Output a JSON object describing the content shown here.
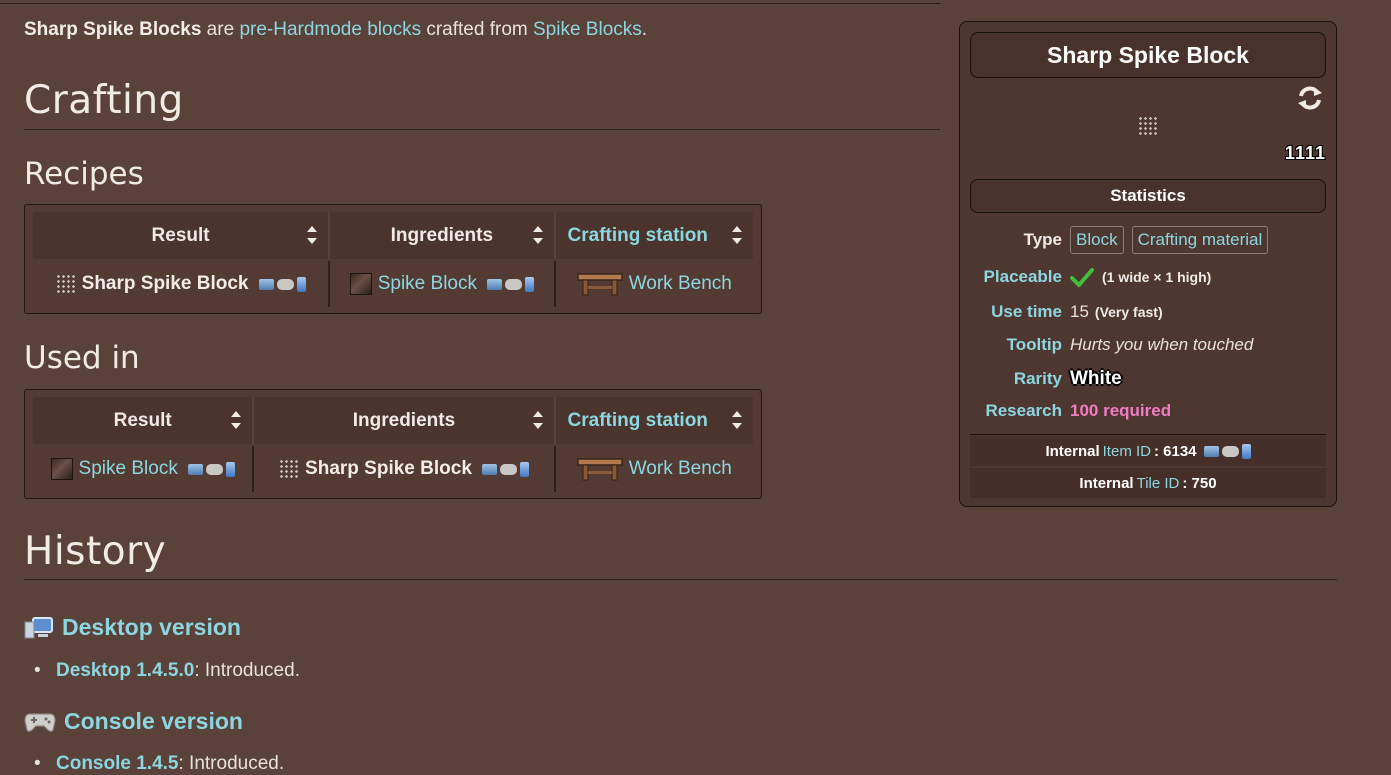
{
  "intro": {
    "bold": "Sharp Spike Blocks",
    "t1": " are ",
    "link1": "pre-Hardmode blocks",
    "t2": " crafted from ",
    "link2": "Spike Blocks",
    "t3": "."
  },
  "sections": {
    "crafting": "Crafting",
    "recipes": "Recipes",
    "used_in": "Used in",
    "history": "History"
  },
  "recipes_table": {
    "headers": [
      "Result",
      "Ingredients",
      "Crafting station"
    ],
    "row": {
      "result": "Sharp Spike Block",
      "ingredient": "Spike Block",
      "station": "Work Bench"
    }
  },
  "used_in_table": {
    "headers": [
      "Result",
      "Ingredients",
      "Crafting station"
    ],
    "row": {
      "result": "Spike Block",
      "ingredient": "Sharp Spike Block",
      "station": "Work Bench"
    }
  },
  "infobox": {
    "title": "Sharp Spike Block",
    "tile_count": "1111",
    "statistics": "Statistics",
    "type_label": "Type",
    "type_tags": [
      "Block",
      "Crafting material"
    ],
    "placeable_label": "Placeable",
    "placeable_size": "(1 wide × 1 high)",
    "use_time_label": "Use time",
    "use_time_value": "15",
    "use_time_note": "(Very fast)",
    "tooltip_label": "Tooltip",
    "tooltip_value": "Hurts you when touched",
    "rarity_label": "Rarity",
    "rarity_value": "White",
    "research_label": "Research",
    "research_value": "100 required",
    "internal_item": {
      "prefix": "Internal",
      "link": "Item ID",
      "value": ": 6134"
    },
    "internal_tile": {
      "prefix": "Internal",
      "link": "Tile ID",
      "value": ": 750"
    }
  },
  "history": {
    "desktop_heading": "Desktop version",
    "desktop_link": "Desktop 1.4.5.0",
    "desktop_text": ": Introduced.",
    "console_heading": "Console version",
    "console_link": "Console 1.4.5",
    "console_text": ": Introduced."
  },
  "colors": {
    "background": "#5a4139",
    "link": "#8cd6e0",
    "research": "#f07cc4"
  }
}
